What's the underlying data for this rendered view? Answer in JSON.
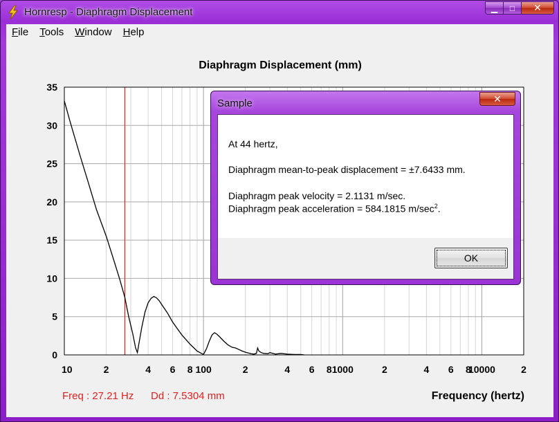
{
  "window": {
    "title": "Hornresp - Diaphragm Displacement",
    "minimize_glyph": "▁",
    "maximize_glyph": "□",
    "close_glyph": "✕",
    "app_icon": "lightning-bolt-icon"
  },
  "menu": [
    {
      "key": "F",
      "rest": "ile"
    },
    {
      "key": "T",
      "rest": "ools"
    },
    {
      "key": "W",
      "rest": "indow"
    },
    {
      "key": "H",
      "rest": "elp"
    }
  ],
  "chart_data": {
    "type": "line",
    "title": "Diaphragm Displacement (mm)",
    "xlabel": "Frequency (hertz)",
    "ylabel": "",
    "xscale": "log",
    "xlim": [
      10,
      20000
    ],
    "ylim": [
      0,
      35
    ],
    "yticks": [
      0,
      5,
      10,
      15,
      20,
      25,
      30,
      35
    ],
    "xtick_labels": [
      {
        "x": 10,
        "label": "10"
      },
      {
        "x": 20,
        "label": "2"
      },
      {
        "x": 40,
        "label": "4"
      },
      {
        "x": 60,
        "label": "6"
      },
      {
        "x": 80,
        "label": "8"
      },
      {
        "x": 100,
        "label": "100"
      },
      {
        "x": 200,
        "label": "2"
      },
      {
        "x": 400,
        "label": "4"
      },
      {
        "x": 600,
        "label": "6"
      },
      {
        "x": 800,
        "label": "8"
      },
      {
        "x": 1000,
        "label": "1000"
      },
      {
        "x": 2000,
        "label": "2"
      },
      {
        "x": 4000,
        "label": "4"
      },
      {
        "x": 6000,
        "label": "6"
      },
      {
        "x": 8000,
        "label": "8"
      },
      {
        "x": 10000,
        "label": "10000"
      },
      {
        "x": 20000,
        "label": "2"
      }
    ],
    "grid": true,
    "line_color": "#000000",
    "cursor": {
      "x": 27.21,
      "color": "#e02020"
    },
    "series": [
      {
        "x": [
          10,
          11,
          13,
          15,
          17,
          20,
          23,
          25,
          27.21,
          29,
          31,
          32.5,
          33.5,
          34,
          36,
          38,
          40,
          42,
          44,
          46,
          48,
          50,
          55,
          60,
          65,
          70,
          80,
          90,
          100,
          105,
          110,
          115,
          120,
          125,
          130,
          140,
          150,
          160,
          170,
          180,
          190,
          200,
          210,
          220,
          230,
          240,
          245,
          250,
          260,
          270,
          290,
          300,
          330,
          360,
          400,
          450,
          500,
          530
        ],
        "y": [
          33.2,
          30.5,
          26.0,
          22.3,
          19.0,
          15.5,
          12.0,
          9.9,
          7.53,
          5.0,
          2.8,
          0.9,
          0.3,
          1.0,
          3.6,
          5.6,
          6.8,
          7.4,
          7.64,
          7.45,
          7.1,
          6.6,
          5.5,
          4.3,
          3.4,
          2.6,
          1.4,
          0.5,
          0.05,
          0.8,
          1.8,
          2.6,
          2.9,
          2.7,
          2.4,
          1.8,
          1.3,
          1.0,
          0.9,
          0.7,
          0.5,
          0.35,
          0.25,
          0.15,
          0.1,
          0.2,
          0.9,
          0.5,
          0.3,
          0.2,
          0.15,
          0.3,
          0.1,
          0.2,
          0.1,
          0.05,
          0.05,
          0.0
        ]
      }
    ],
    "readout_freq": "Freq : 27.21 Hz",
    "readout_dd": "Dd : 7.5304 mm",
    "readout_color": "#e02020"
  },
  "dialog": {
    "title": "Sample",
    "close_glyph": "✕",
    "line1": "At 44 hertz,",
    "line2": "Diaphragm mean-to-peak displacement = ±7.6433 mm.",
    "line3": "Diaphragm peak velocity = 2.1131 m/sec.",
    "line4_main": "Diaphragm peak acceleration = 584.1815 m/sec",
    "line4_sup": "2",
    "line4_end": ".",
    "ok_label": "OK"
  }
}
